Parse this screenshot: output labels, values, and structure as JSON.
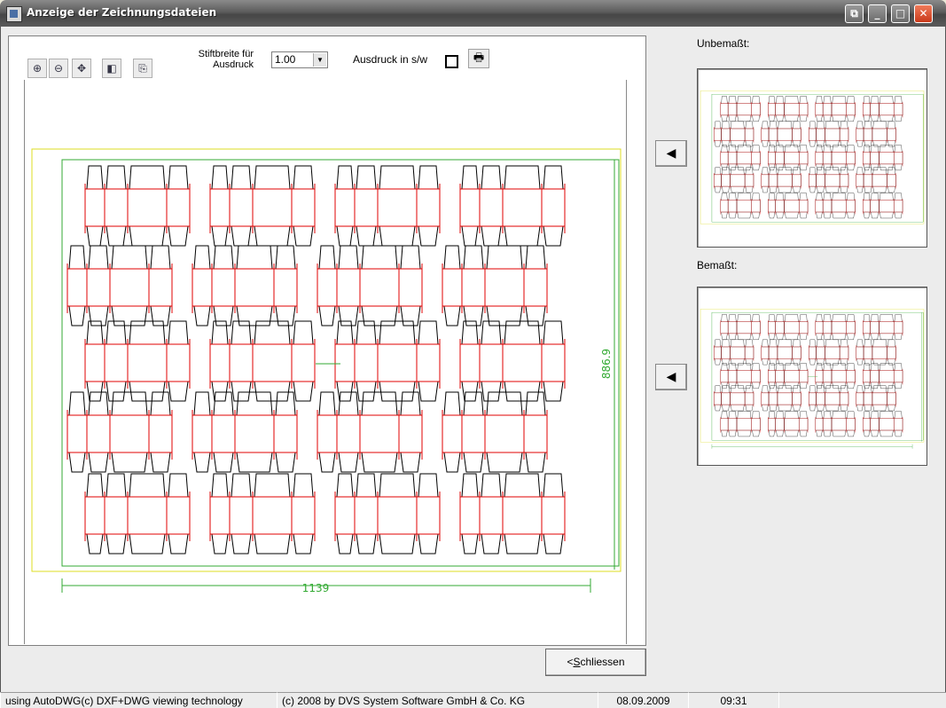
{
  "window": {
    "title": "Anzeige der Zeichnungsdateien"
  },
  "toolbar": {
    "pen_width_label": "Stiftbreite für\nAusdruck",
    "pen_width_value": "1.00",
    "bw_print_label": "Ausdruck in s/w",
    "bw_print_checked": false
  },
  "drawing": {
    "dimension_horizontal": "1139",
    "dimension_vertical": "886.9",
    "colors": {
      "cut": "#000000",
      "crease": "#e00000",
      "dimension": "#33aa33",
      "sheet": "#dddd22"
    }
  },
  "side": {
    "undimensioned_label": "Unbemaßt:",
    "dimensioned_label": "Bemaßt:"
  },
  "buttons": {
    "close_label": "<Schliessen",
    "close_mnemonic": "S"
  },
  "statusbar": {
    "tech": "using AutoDWG(c) DXF+DWG viewing technology",
    "copyright": "(c) 2008 by DVS System Software GmbH & Co. KG",
    "date": "08.09.2009",
    "time": "09:31"
  }
}
